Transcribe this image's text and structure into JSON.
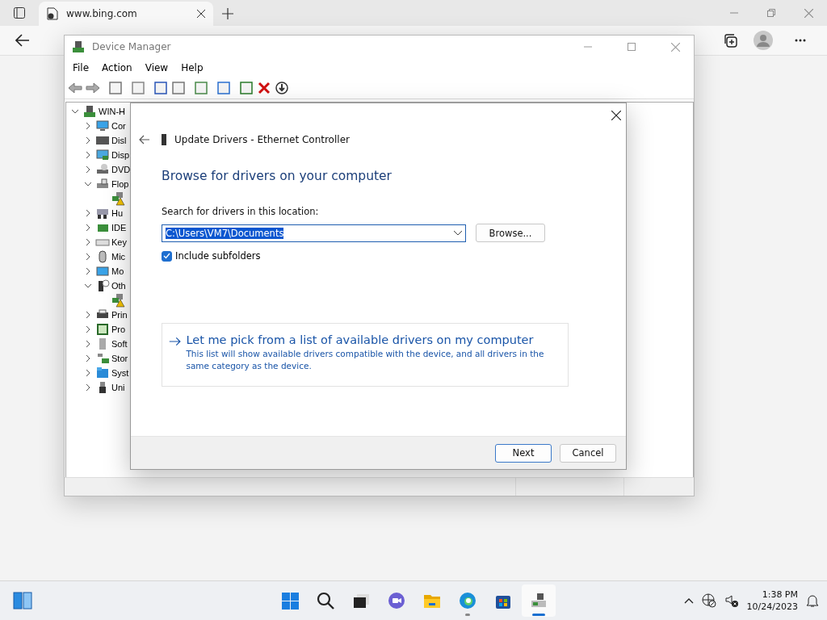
{
  "browser": {
    "tabs": [
      {
        "title": "www.bing.com",
        "selected": true
      }
    ]
  },
  "device_manager": {
    "title": "Device Manager",
    "menu": [
      "File",
      "Action",
      "View",
      "Help"
    ],
    "tree": {
      "label": "WIN-H",
      "expanded": true,
      "children": [
        {
          "kind": "computer",
          "label": "Cor",
          "expanded": false
        },
        {
          "kind": "disk",
          "label": "Disl",
          "expanded": false
        },
        {
          "kind": "display",
          "label": "Disp",
          "expanded": false
        },
        {
          "kind": "dvd",
          "label": "DVD",
          "expanded": false
        },
        {
          "kind": "floppy",
          "label": "Flop",
          "expanded": true,
          "children": [
            {
              "warning": true
            }
          ]
        },
        {
          "kind": "hid",
          "label": "Hu",
          "expanded": false
        },
        {
          "kind": "ide",
          "label": "IDE",
          "expanded": false
        },
        {
          "kind": "keyboard",
          "label": "Key",
          "expanded": false
        },
        {
          "kind": "mouse",
          "label": "Mic",
          "expanded": false
        },
        {
          "kind": "monitor",
          "label": "Mo",
          "expanded": false
        },
        {
          "kind": "other",
          "label": "Oth",
          "expanded": true,
          "children": [
            {
              "warning": true
            }
          ]
        },
        {
          "kind": "printer",
          "label": "Prin",
          "expanded": false
        },
        {
          "kind": "processor",
          "label": "Pro",
          "expanded": false
        },
        {
          "kind": "software",
          "label": "Soft",
          "expanded": false
        },
        {
          "kind": "storage",
          "label": "Stor",
          "expanded": false
        },
        {
          "kind": "system",
          "label": "Syst",
          "expanded": false
        },
        {
          "kind": "usb",
          "label": "Uni",
          "expanded": false
        }
      ]
    }
  },
  "dialog": {
    "title": "Update Drivers - Ethernet Controller",
    "heading": "Browse for drivers on your computer",
    "location_label": "Search for drivers in this location:",
    "location_value": "C:\\Users\\VM7\\Documents",
    "browse_button": "Browse...",
    "include_subfolders": {
      "label": "Include subfolders",
      "checked": true
    },
    "pick_option": {
      "title": "Let me pick from a list of available drivers on my computer",
      "description": "This list will show available drivers compatible with the device, and all drivers in the same category as the device."
    },
    "buttons": [
      {
        "label": "Next",
        "default": true
      },
      {
        "label": "Cancel",
        "default": false
      }
    ]
  },
  "taskbar": {
    "apps": [
      {
        "kind": "start",
        "running": false,
        "active": false
      },
      {
        "kind": "search",
        "running": false,
        "active": false
      },
      {
        "kind": "taskview",
        "running": false,
        "active": false
      },
      {
        "kind": "chat",
        "running": false,
        "active": false
      },
      {
        "kind": "explorer",
        "running": false,
        "active": false
      },
      {
        "kind": "edge",
        "running": true,
        "active": false
      },
      {
        "kind": "store",
        "running": false,
        "active": false
      },
      {
        "kind": "devmgr",
        "running": true,
        "active": true
      }
    ],
    "time": "1:38 PM",
    "date": "10/24/2023"
  }
}
